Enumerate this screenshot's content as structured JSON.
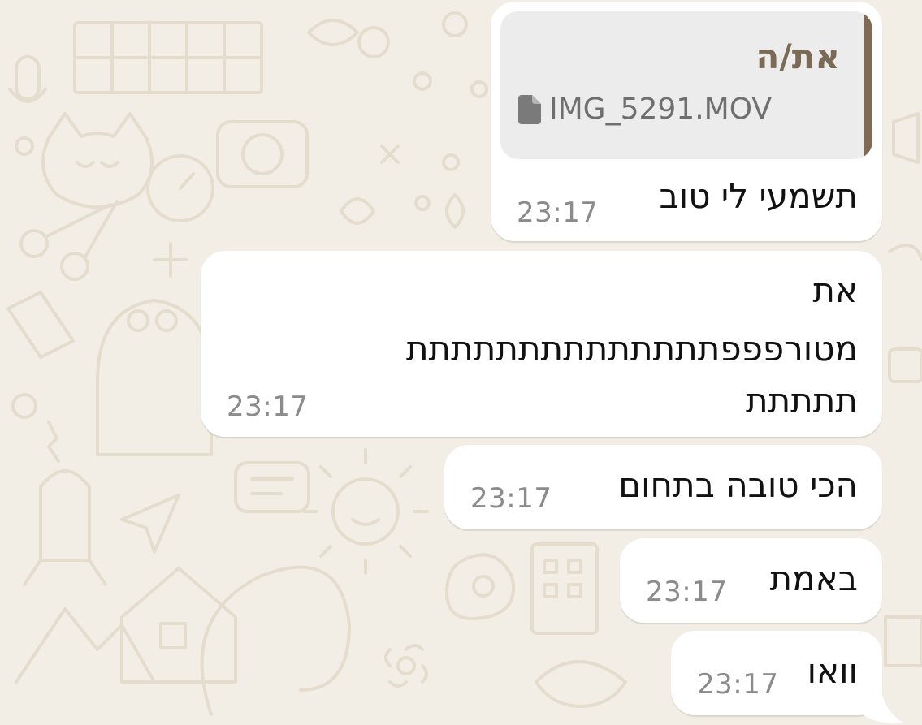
{
  "chat": {
    "messages": [
      {
        "quote": {
          "author": "את/ה",
          "file_icon": "document-icon",
          "file_name": "IMG_5291.MOV"
        },
        "lines": [
          "תשמעי לי טוב"
        ],
        "time": "23:17"
      },
      {
        "lines": [
          "את",
          "מטורפפפתתתתתתתתתתתתתת",
          "תתתתת"
        ],
        "time": "23:17"
      },
      {
        "lines": [
          "הכי טובה בתחום"
        ],
        "time": "23:17"
      },
      {
        "lines": [
          "באמת"
        ],
        "time": "23:17"
      },
      {
        "lines": [
          "וואו"
        ],
        "time": "23:17"
      }
    ]
  },
  "colors": {
    "wallpaper": "#f3eee5",
    "doodle": "#e4dccd",
    "bubble": "#ffffff",
    "quote_background": "#ececec",
    "quote_accent": "#7f6b55",
    "timestamp": "#8b8b8b"
  }
}
